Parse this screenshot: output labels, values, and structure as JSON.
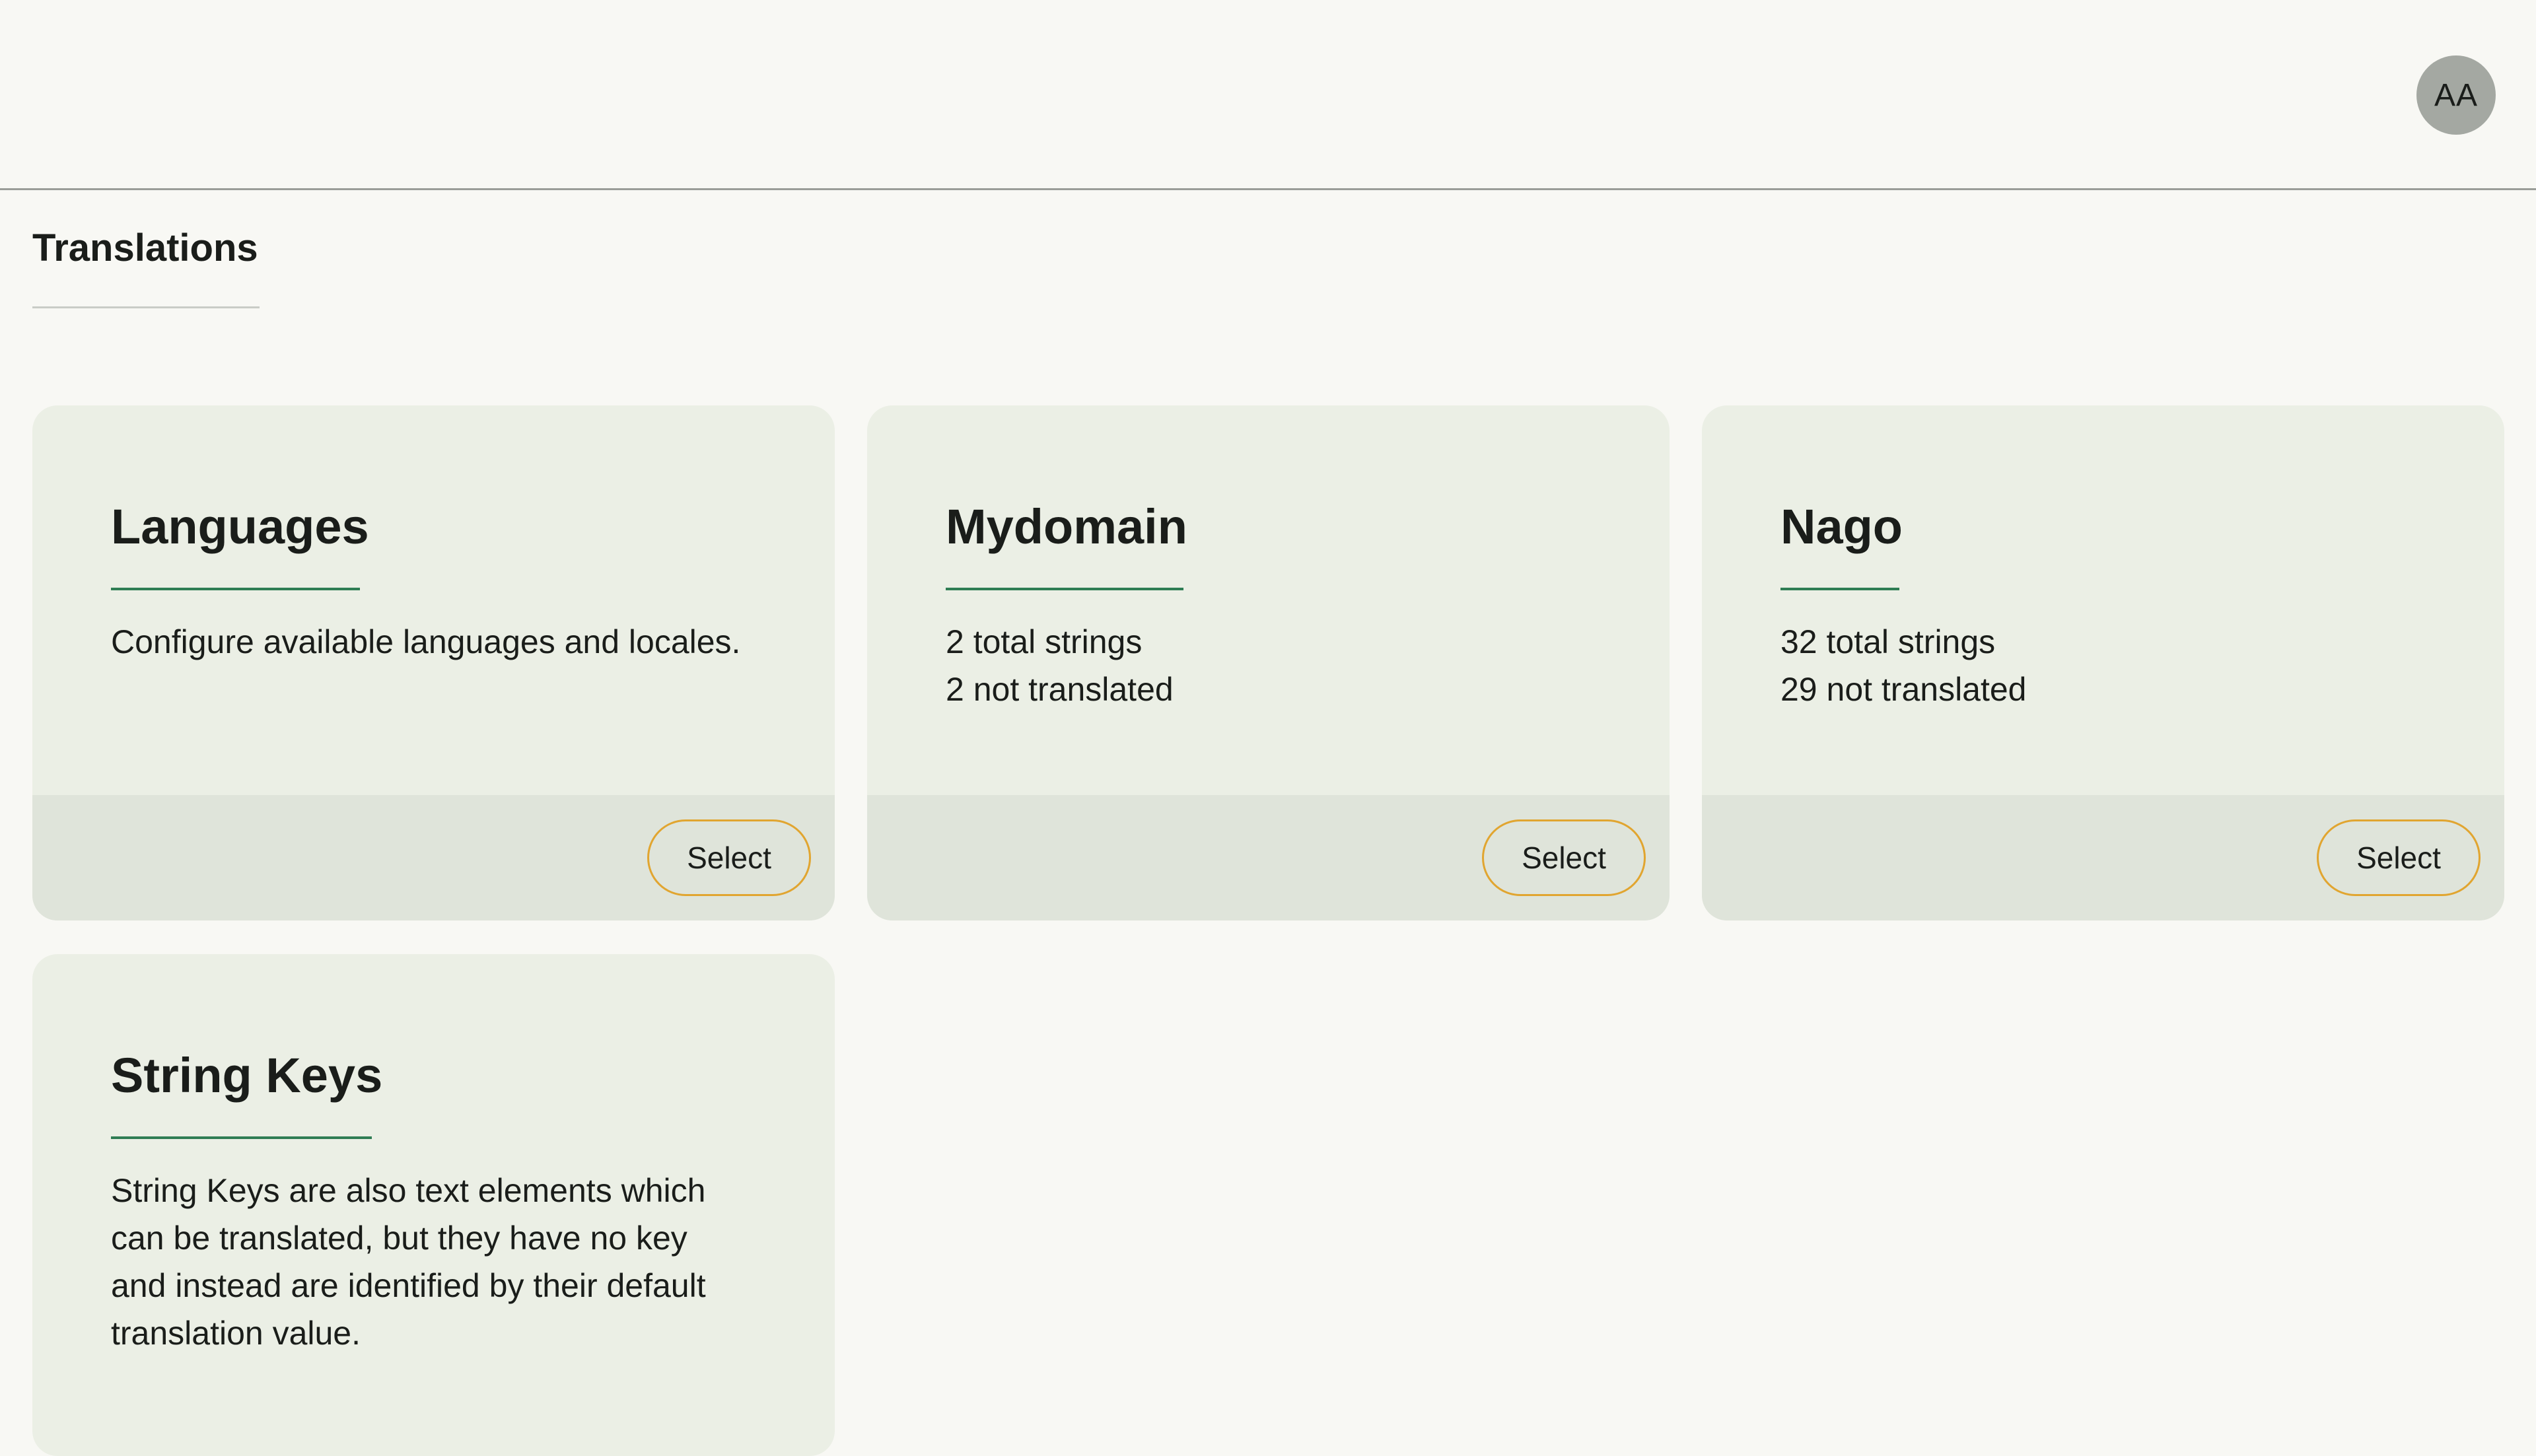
{
  "header": {
    "avatar_initials": "AA"
  },
  "page": {
    "title": "Translations"
  },
  "cards": [
    {
      "title": "Languages",
      "lines": [
        "Configure available languages and locales."
      ],
      "button_label": "Select"
    },
    {
      "title": "Mydomain",
      "lines": [
        "2 total strings",
        "2 not translated"
      ],
      "button_label": "Select"
    },
    {
      "title": "Nago",
      "lines": [
        "32 total strings",
        "29 not translated"
      ],
      "button_label": "Select"
    },
    {
      "title": "String Keys",
      "lines": [
        "String Keys are also text elements which can be translated, but they have no key and instead are identified by their default translation value."
      ]
    }
  ],
  "colors": {
    "background": "#f8f8f4",
    "card": "#ebefe5",
    "card_footer": "#dfe4da",
    "accent_rule": "#2f7d54",
    "button_border": "#e1a530",
    "avatar": "#a4a8a2"
  }
}
